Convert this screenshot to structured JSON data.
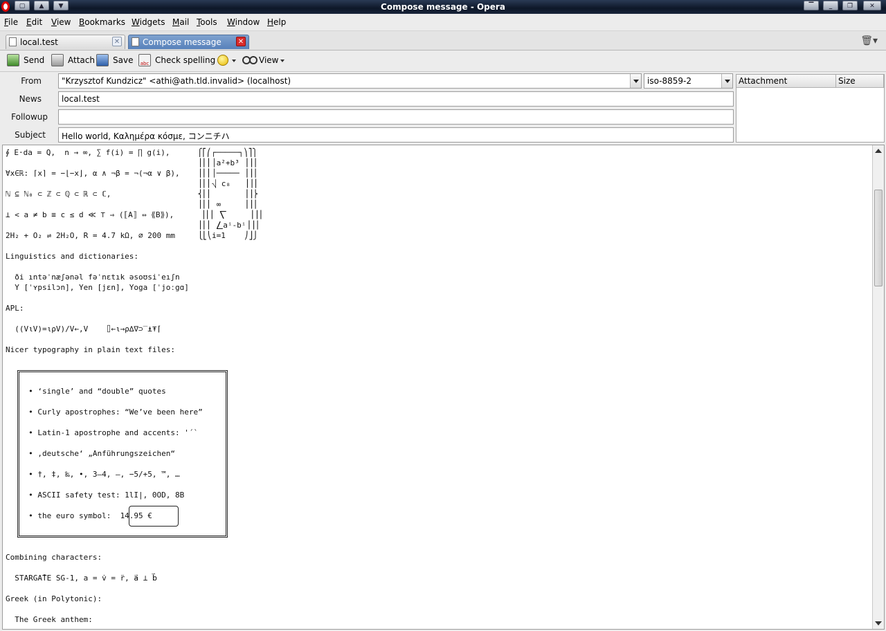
{
  "window": {
    "title": "Compose message - Opera"
  },
  "menu": [
    "File",
    "Edit",
    "View",
    "Bookmarks",
    "Widgets",
    "Mail",
    "Tools",
    "Window",
    "Help"
  ],
  "tabs": [
    {
      "label": "local.test",
      "active": false
    },
    {
      "label": "Compose message",
      "active": true
    }
  ],
  "toolbar": {
    "send": "Send",
    "attach": "Attach",
    "save": "Save",
    "check_spelling": "Check spelling",
    "view": "View"
  },
  "headers": {
    "from_label": "From",
    "from_value": "\"Krzysztof Kundzicz\" <athi@ath.tld.invalid>  (localhost)",
    "encoding": "iso-8859-2",
    "news_label": "News",
    "news_value": "local.test",
    "followup_label": "Followup",
    "followup_value": "",
    "subject_label": "Subject",
    "subject_value": "Hello world, Καλημέρα κόσμε, コンニチハ"
  },
  "attachments": {
    "col_attachment": "Attachment",
    "col_size": "Size"
  },
  "body": {
    "lines": [
      "∮ E⋅da = Q,  n → ∞, ∑ f(i) = ∏ g(i),      ⎧⎡⎛┌─────┐⎞⎤⎫",
      "                                          ⎪⎢⎜│a²+b³ ⎟⎥⎪",
      "∀x∈ℝ: ⌈x⌉ = −⌊−x⌋, α ∧ ¬β = ¬(¬α ∨ β),    ⎪⎢⎜│───── ⎟⎥⎪",
      "                                          ⎪⎢⎜⎷ c₈   ⎟⎥⎪",
      "ℕ ⊆ ℕ₀ ⊂ ℤ ⊂ ℚ ⊂ ℝ ⊂ ℂ,                   ⎨⎢⎜       ⎟⎥⎬",
      "                                          ⎪⎢⎜ ∞     ⎟⎥⎪",
      "⊥ < a ≠ b ≡ c ≤ d ≪ ⊤ ⇒ (⟦A⟧ ⇔ ⟪B⟫),      ⎪⎢⎜ ⎲     ⎟⎥⎪",
      "                                          ⎪⎢⎜ ⎳aⁱ-bⁱ⎟⎥⎪",
      "2H₂ + O₂ ⇌ 2H₂O, R = 4.7 kΩ, ⌀ 200 mm     ⎩⎣⎝i=1    ⎠⎦⎭",
      "",
      "Linguistics and dictionaries:",
      "",
      "  ði ıntəˈnæʃənəl fəˈnɛtık əsoʊsiˈeıʃn",
      "  Y [ˈʏpsilɔn], Yen [jɛn], Yoga [ˈjoːgɑ]",
      "",
      "APL:",
      "",
      "  ((V⍳V)=⍳⍴V)/V←,V    ⌷←⍳→⍴∆∇⊃‾⍎⍕⌈",
      "",
      "Nicer typography in plain text files:",
      "",
      "",
      "",
      "     • ‘single’ and “double” quotes",
      "",
      "     • Curly apostrophes: “We’ve been here”",
      "",
      "     • Latin-1 apostrophe and accents: '´`",
      "",
      "     • ‚deutsche‘ „Anführungszeichen“",
      "",
      "     • †, ‡, ‰, •, 3–4, —, −5/+5, ™, …",
      "",
      "     • ASCII safety test: 1lI|, 0OD, 8B",
      "",
      "     • the euro symbol:  14.95 €",
      "",
      "",
      "",
      "Combining characters:",
      "",
      "  STARGΑ̊TE SG-1, a = v̇ = r̈, a⃑ ⊥ b⃑",
      "",
      "Greek (in Polytonic):",
      "",
      "  The Greek anthem:"
    ]
  }
}
